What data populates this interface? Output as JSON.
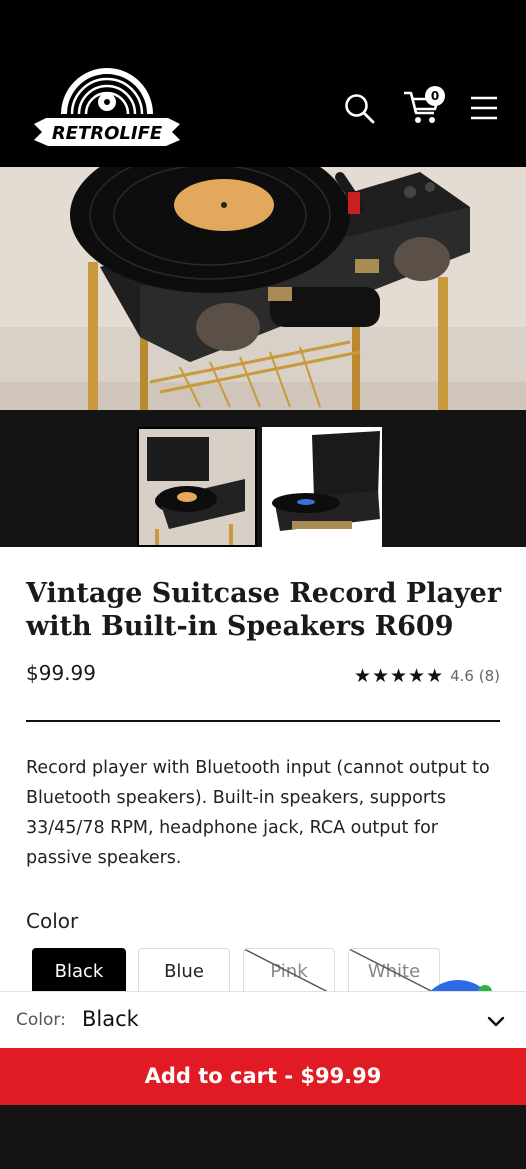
{
  "header": {
    "logo_text": "RETROLIFE",
    "cart_count": "0"
  },
  "product": {
    "title": "Vintage Suitcase Record Player with Built-in Speakers R609",
    "price": "$99.99",
    "stars": "★★★★★",
    "rating": 4.6,
    "rating_text": "4.6 (8)",
    "description": "Record player with Bluetooth input (cannot output to Bluetooth speakers). Built-in speakers, supports 33/45/78 RPM, headphone jack, RCA output for passive speakers.",
    "color_label": "Color",
    "color_options": [
      {
        "label": "Black",
        "state": "selected"
      },
      {
        "label": "Blue",
        "state": "available"
      },
      {
        "label": "Pink",
        "state": "sold-out"
      },
      {
        "label": "White",
        "state": "sold-out"
      }
    ]
  },
  "sticky": {
    "select_label": "Color:",
    "select_value": "Black",
    "add_to_cart": "Add to cart - $99.99"
  },
  "colors": {
    "header_bg": "#000000",
    "cta_red": "#e01b23",
    "chat_blue": "#2d6ae8",
    "chat_green": "#2db24a"
  },
  "icons": [
    "search-icon",
    "cart-icon",
    "menu-icon",
    "chevron-down-icon"
  ]
}
